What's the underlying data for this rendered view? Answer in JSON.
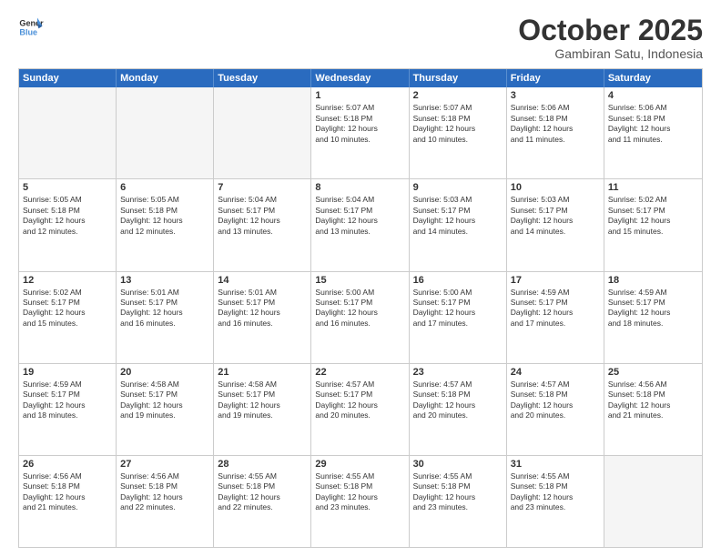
{
  "logo": {
    "line1": "General",
    "line2": "Blue"
  },
  "title": "October 2025",
  "location": "Gambiran Satu, Indonesia",
  "header_days": [
    "Sunday",
    "Monday",
    "Tuesday",
    "Wednesday",
    "Thursday",
    "Friday",
    "Saturday"
  ],
  "weeks": [
    [
      {
        "day": "",
        "info": ""
      },
      {
        "day": "",
        "info": ""
      },
      {
        "day": "",
        "info": ""
      },
      {
        "day": "1",
        "info": "Sunrise: 5:07 AM\nSunset: 5:18 PM\nDaylight: 12 hours\nand 10 minutes."
      },
      {
        "day": "2",
        "info": "Sunrise: 5:07 AM\nSunset: 5:18 PM\nDaylight: 12 hours\nand 10 minutes."
      },
      {
        "day": "3",
        "info": "Sunrise: 5:06 AM\nSunset: 5:18 PM\nDaylight: 12 hours\nand 11 minutes."
      },
      {
        "day": "4",
        "info": "Sunrise: 5:06 AM\nSunset: 5:18 PM\nDaylight: 12 hours\nand 11 minutes."
      }
    ],
    [
      {
        "day": "5",
        "info": "Sunrise: 5:05 AM\nSunset: 5:18 PM\nDaylight: 12 hours\nand 12 minutes."
      },
      {
        "day": "6",
        "info": "Sunrise: 5:05 AM\nSunset: 5:18 PM\nDaylight: 12 hours\nand 12 minutes."
      },
      {
        "day": "7",
        "info": "Sunrise: 5:04 AM\nSunset: 5:17 PM\nDaylight: 12 hours\nand 13 minutes."
      },
      {
        "day": "8",
        "info": "Sunrise: 5:04 AM\nSunset: 5:17 PM\nDaylight: 12 hours\nand 13 minutes."
      },
      {
        "day": "9",
        "info": "Sunrise: 5:03 AM\nSunset: 5:17 PM\nDaylight: 12 hours\nand 14 minutes."
      },
      {
        "day": "10",
        "info": "Sunrise: 5:03 AM\nSunset: 5:17 PM\nDaylight: 12 hours\nand 14 minutes."
      },
      {
        "day": "11",
        "info": "Sunrise: 5:02 AM\nSunset: 5:17 PM\nDaylight: 12 hours\nand 15 minutes."
      }
    ],
    [
      {
        "day": "12",
        "info": "Sunrise: 5:02 AM\nSunset: 5:17 PM\nDaylight: 12 hours\nand 15 minutes."
      },
      {
        "day": "13",
        "info": "Sunrise: 5:01 AM\nSunset: 5:17 PM\nDaylight: 12 hours\nand 16 minutes."
      },
      {
        "day": "14",
        "info": "Sunrise: 5:01 AM\nSunset: 5:17 PM\nDaylight: 12 hours\nand 16 minutes."
      },
      {
        "day": "15",
        "info": "Sunrise: 5:00 AM\nSunset: 5:17 PM\nDaylight: 12 hours\nand 16 minutes."
      },
      {
        "day": "16",
        "info": "Sunrise: 5:00 AM\nSunset: 5:17 PM\nDaylight: 12 hours\nand 17 minutes."
      },
      {
        "day": "17",
        "info": "Sunrise: 4:59 AM\nSunset: 5:17 PM\nDaylight: 12 hours\nand 17 minutes."
      },
      {
        "day": "18",
        "info": "Sunrise: 4:59 AM\nSunset: 5:17 PM\nDaylight: 12 hours\nand 18 minutes."
      }
    ],
    [
      {
        "day": "19",
        "info": "Sunrise: 4:59 AM\nSunset: 5:17 PM\nDaylight: 12 hours\nand 18 minutes."
      },
      {
        "day": "20",
        "info": "Sunrise: 4:58 AM\nSunset: 5:17 PM\nDaylight: 12 hours\nand 19 minutes."
      },
      {
        "day": "21",
        "info": "Sunrise: 4:58 AM\nSunset: 5:17 PM\nDaylight: 12 hours\nand 19 minutes."
      },
      {
        "day": "22",
        "info": "Sunrise: 4:57 AM\nSunset: 5:17 PM\nDaylight: 12 hours\nand 20 minutes."
      },
      {
        "day": "23",
        "info": "Sunrise: 4:57 AM\nSunset: 5:18 PM\nDaylight: 12 hours\nand 20 minutes."
      },
      {
        "day": "24",
        "info": "Sunrise: 4:57 AM\nSunset: 5:18 PM\nDaylight: 12 hours\nand 20 minutes."
      },
      {
        "day": "25",
        "info": "Sunrise: 4:56 AM\nSunset: 5:18 PM\nDaylight: 12 hours\nand 21 minutes."
      }
    ],
    [
      {
        "day": "26",
        "info": "Sunrise: 4:56 AM\nSunset: 5:18 PM\nDaylight: 12 hours\nand 21 minutes."
      },
      {
        "day": "27",
        "info": "Sunrise: 4:56 AM\nSunset: 5:18 PM\nDaylight: 12 hours\nand 22 minutes."
      },
      {
        "day": "28",
        "info": "Sunrise: 4:55 AM\nSunset: 5:18 PM\nDaylight: 12 hours\nand 22 minutes."
      },
      {
        "day": "29",
        "info": "Sunrise: 4:55 AM\nSunset: 5:18 PM\nDaylight: 12 hours\nand 23 minutes."
      },
      {
        "day": "30",
        "info": "Sunrise: 4:55 AM\nSunset: 5:18 PM\nDaylight: 12 hours\nand 23 minutes."
      },
      {
        "day": "31",
        "info": "Sunrise: 4:55 AM\nSunset: 5:18 PM\nDaylight: 12 hours\nand 23 minutes."
      },
      {
        "day": "",
        "info": ""
      }
    ]
  ]
}
